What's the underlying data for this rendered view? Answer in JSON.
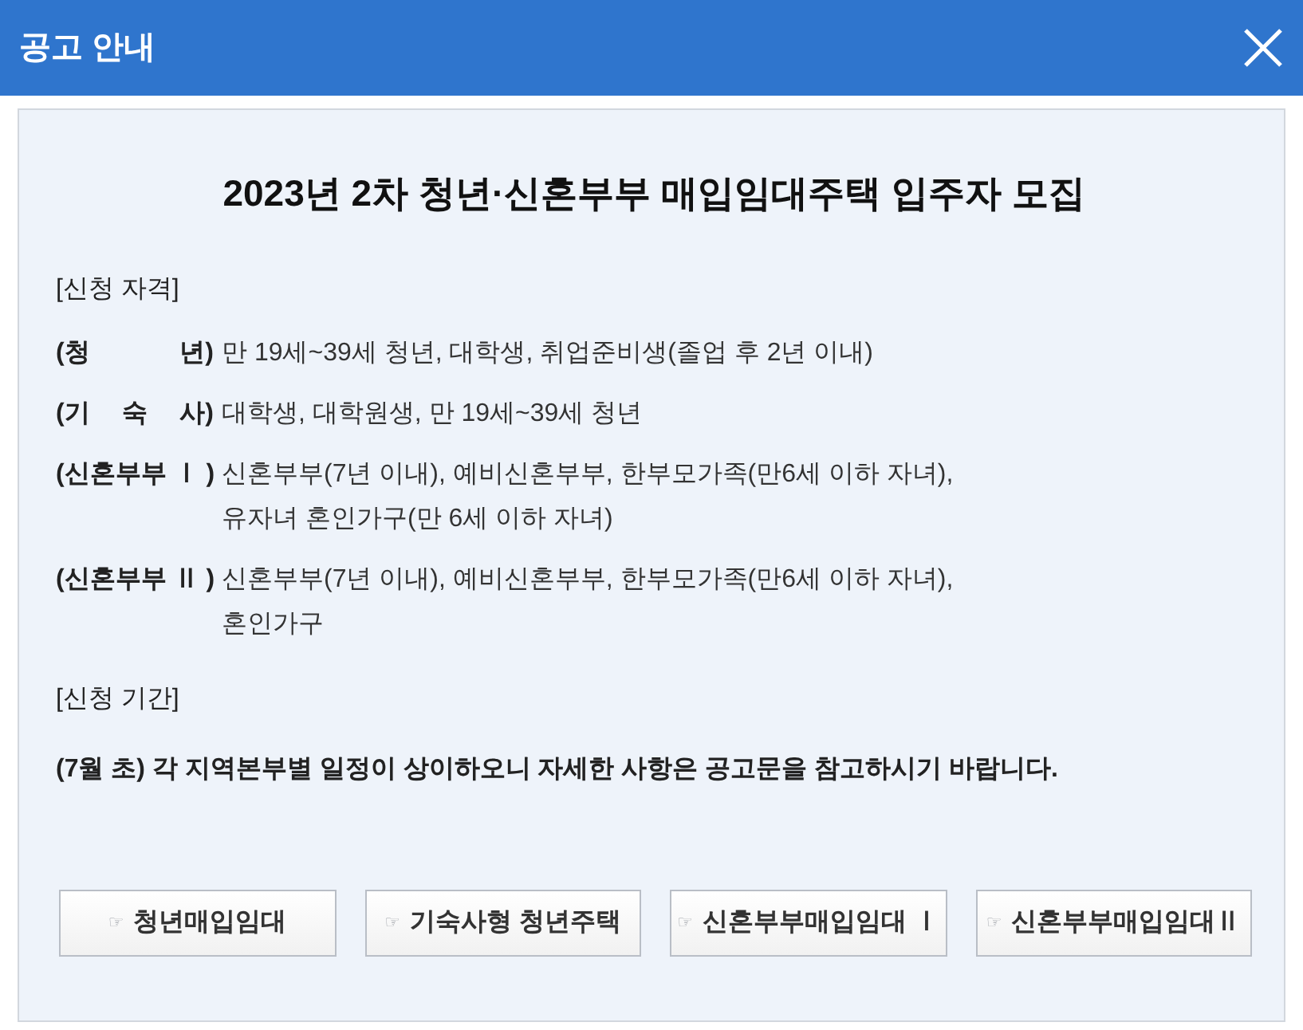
{
  "window": {
    "title": "공고 안내"
  },
  "notice": {
    "title": "2023년 2차 청년·신혼부부 매입임대주택 입주자 모집",
    "sections": [
      {
        "kind": "eligibility",
        "heading": "[신청 자격]",
        "rows": [
          {
            "label": "(청 년)",
            "lines": [
              "만 19세~39세 청년, 대학생, 취업준비생(졸업 후 2년 이내)"
            ]
          },
          {
            "label": "(기 숙 사)",
            "lines": [
              "대학생, 대학원생, 만 19세~39세 청년"
            ]
          },
          {
            "label": "(신혼부부 Ⅰ )",
            "lines": [
              "신혼부부(7년 이내), 예비신혼부부, 한부모가족(만6세 이하 자녀),",
              "유자녀 혼인가구(만 6세 이하 자녀)"
            ]
          },
          {
            "label": "(신혼부부 Ⅱ )",
            "lines": [
              "신혼부부(7년 이내), 예비신혼부부, 한부모가족(만6세 이하 자녀),",
              "혼인가구"
            ]
          }
        ]
      },
      {
        "kind": "period",
        "heading": "[신청 기간]",
        "text": "(7월 초) 각 지역본부별 일정이 상이하오니 자세한 사항은 공고문을 참고하시기 바랍니다."
      }
    ]
  },
  "buttons": [
    {
      "icon": "☞",
      "label": "청년매입임대"
    },
    {
      "icon": "☞",
      "label": "기숙사형 청년주택"
    },
    {
      "icon": "☞",
      "label": "신혼부부매입임대 Ⅰ"
    },
    {
      "icon": "☞",
      "label": "신혼부부매입임대Ⅱ"
    }
  ]
}
